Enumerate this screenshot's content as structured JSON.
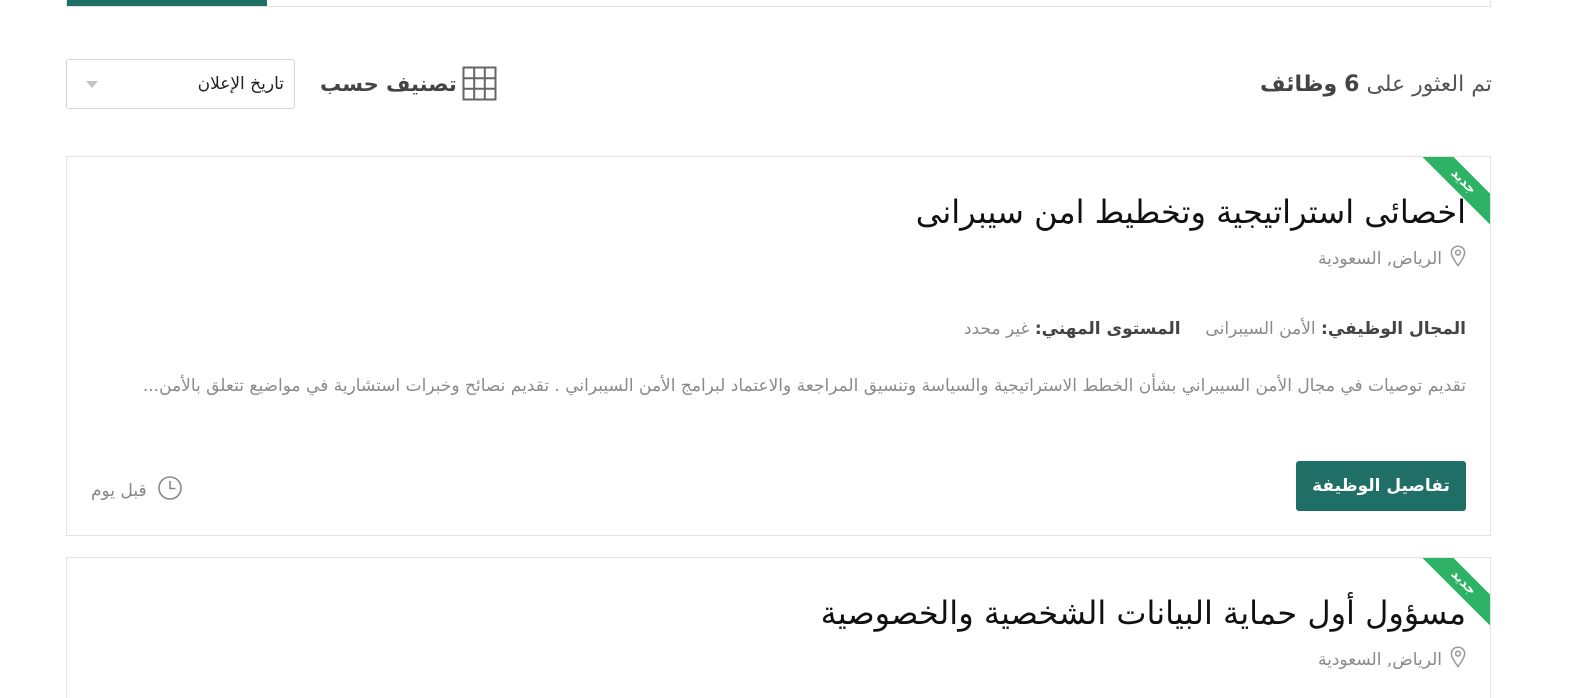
{
  "colors": {
    "primary": "#1f6f66",
    "new_badge": "#2eb266",
    "muted_text": "#8a8a8a",
    "border": "#e3e3e3"
  },
  "toolbar": {
    "results_prefix": "تم العثور على",
    "results_count": "6",
    "results_suffix": "وظائف",
    "sort_label": "تصنيف حسب",
    "sort_selected": "تاريخ الإعلان",
    "grid_icon": "grid-view-icon"
  },
  "jobs": [
    {
      "badge": "جديد",
      "title": "اخصائى استراتيجية وتخطيط امن سيبرانى",
      "location": "الرياض, السعودية",
      "field_label": "المجال الوظيفي:",
      "field_value": "الأمن السيبرانى",
      "level_label": "المستوى المهني:",
      "level_value": "غير محدد",
      "description": "تقديم توصيات في مجال الأمن السيبراني بشأن الخطط الاستراتيجية والسياسة وتنسيق المراجعة والاعتماد لبرامج الأمن السيبراني . تقديم نصائح وخبرات استشارية في مواضيع تتعلق بالأمن...",
      "button_label": "تفاصيل الوظيفة",
      "posted": "قبل يوم"
    },
    {
      "badge": "جديد",
      "title": "مسؤول أول حماية البيانات الشخصية والخصوصية",
      "location": "الرياض, السعودية"
    }
  ]
}
